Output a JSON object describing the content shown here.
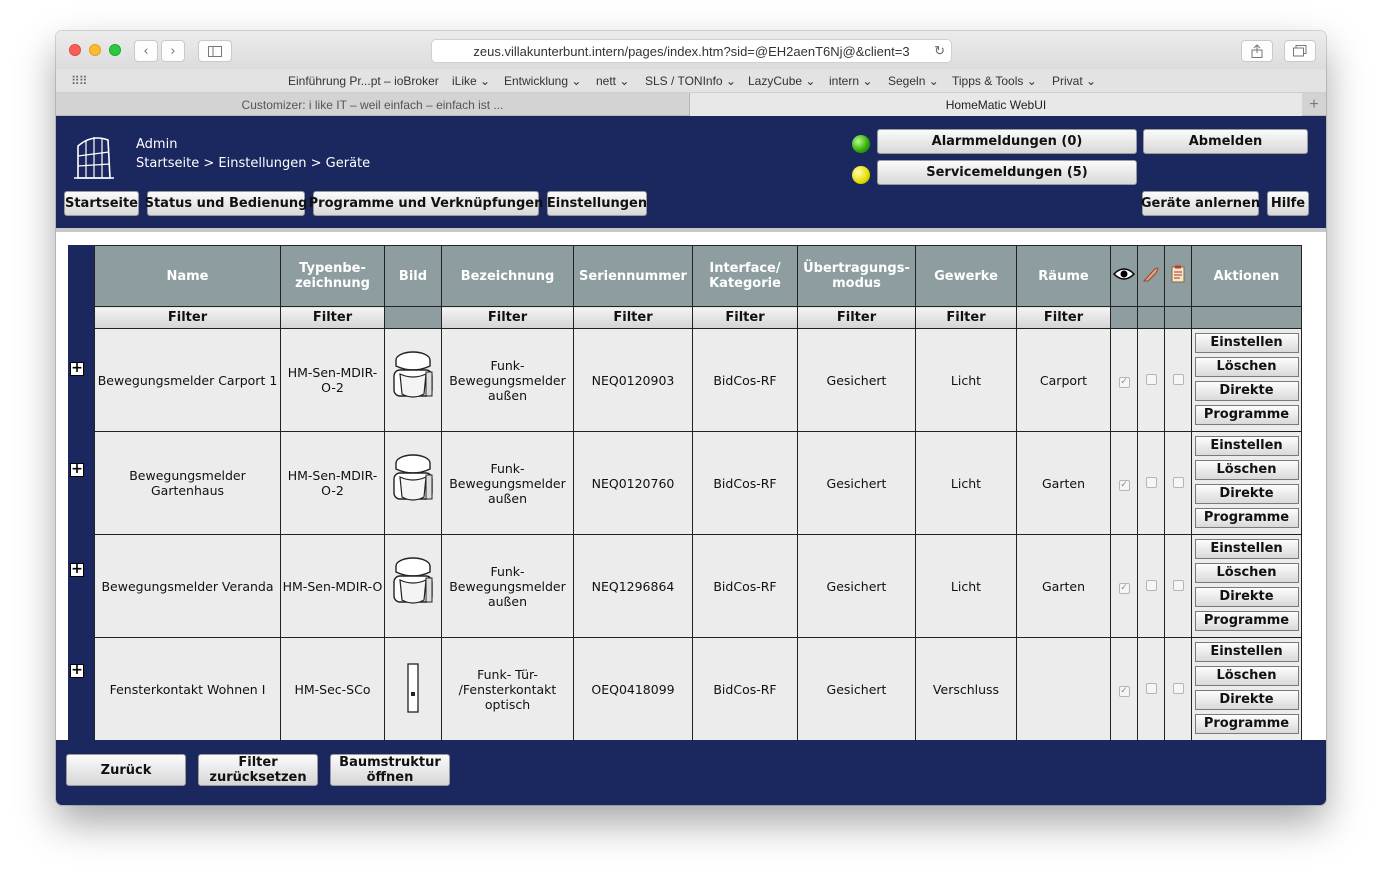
{
  "browser": {
    "url": "zeus.villakunterbunt.intern/pages/index.htm?sid=@EH2aenT6Nj@&client=3",
    "bookmarks": [
      "Einführung Pr...pt – ioBroker",
      "iLike ⌄",
      "Entwicklung ⌄",
      "nett ⌄",
      "SLS / TONInfo ⌄",
      "LazyCube ⌄",
      "intern ⌄",
      "Segeln ⌄",
      "Tipps & Tools ⌄",
      "Privat ⌄"
    ],
    "tabs": [
      "Customizer: i like IT – weil einfach – einfach ist ...",
      "HomeMatic WebUI"
    ]
  },
  "header": {
    "user": "Admin",
    "breadcrumb": "Startseite > Einstellungen > Geräte",
    "alarm_label": "Alarmmeldungen (0)",
    "service_label": "Servicemeldungen (5)",
    "logout_label": "Abmelden",
    "learn_label": "Geräte anlernen",
    "help_label": "Hilfe",
    "nav": [
      "Startseite",
      "Status und Bedienung",
      "Programme und Verknüpfungen",
      "Einstellungen"
    ],
    "status_colors": {
      "alarm_led": "#2ea800",
      "service_led": "#e2de00"
    }
  },
  "table": {
    "columns": [
      "Name",
      "Typenbe-\nzeichnung",
      "Bild",
      "Bezeichnung",
      "Seriennummer",
      "Interface/\nKategorie",
      "Übertragungs-\nmodus",
      "Gewerke",
      "Räume",
      "Aktionen"
    ],
    "filter_label": "Filter",
    "action_labels": [
      "Einstellen",
      "Löschen",
      "Direkte",
      "Programme"
    ],
    "rows": [
      {
        "name": "Bewegungsmelder Carport 1",
        "type": "HM-Sen-MDIR-O-2",
        "desc": "Funk-Bewegungsmelder außen",
        "serial": "NEQ0120903",
        "iface": "BidCos-RF",
        "mode": "Gesichert",
        "trade": "Licht",
        "room": "Carport",
        "img": "motion"
      },
      {
        "name": "Bewegungsmelder Gartenhaus",
        "type": "HM-Sen-MDIR-O-2",
        "desc": "Funk-Bewegungsmelder außen",
        "serial": "NEQ0120760",
        "iface": "BidCos-RF",
        "mode": "Gesichert",
        "trade": "Licht",
        "room": "Garten",
        "img": "motion"
      },
      {
        "name": "Bewegungsmelder Veranda",
        "type": "HM-Sen-MDIR-O",
        "desc": "Funk-Bewegungsmelder außen",
        "serial": "NEQ1296864",
        "iface": "BidCos-RF",
        "mode": "Gesichert",
        "trade": "Licht",
        "room": "Garten",
        "img": "motion"
      },
      {
        "name": "Fensterkontakt Wohnen I",
        "type": "HM-Sec-SCo",
        "desc": "Funk- Tür- /Fensterkontakt optisch",
        "serial": "OEQ0418099",
        "iface": "BidCos-RF",
        "mode": "Gesichert",
        "trade": "Verschluss",
        "room": "",
        "img": "contact"
      }
    ]
  },
  "footer": {
    "back_label": "Zurück",
    "reset_label": "Filter zurücksetzen",
    "tree_label": "Baumstruktur öffnen"
  }
}
